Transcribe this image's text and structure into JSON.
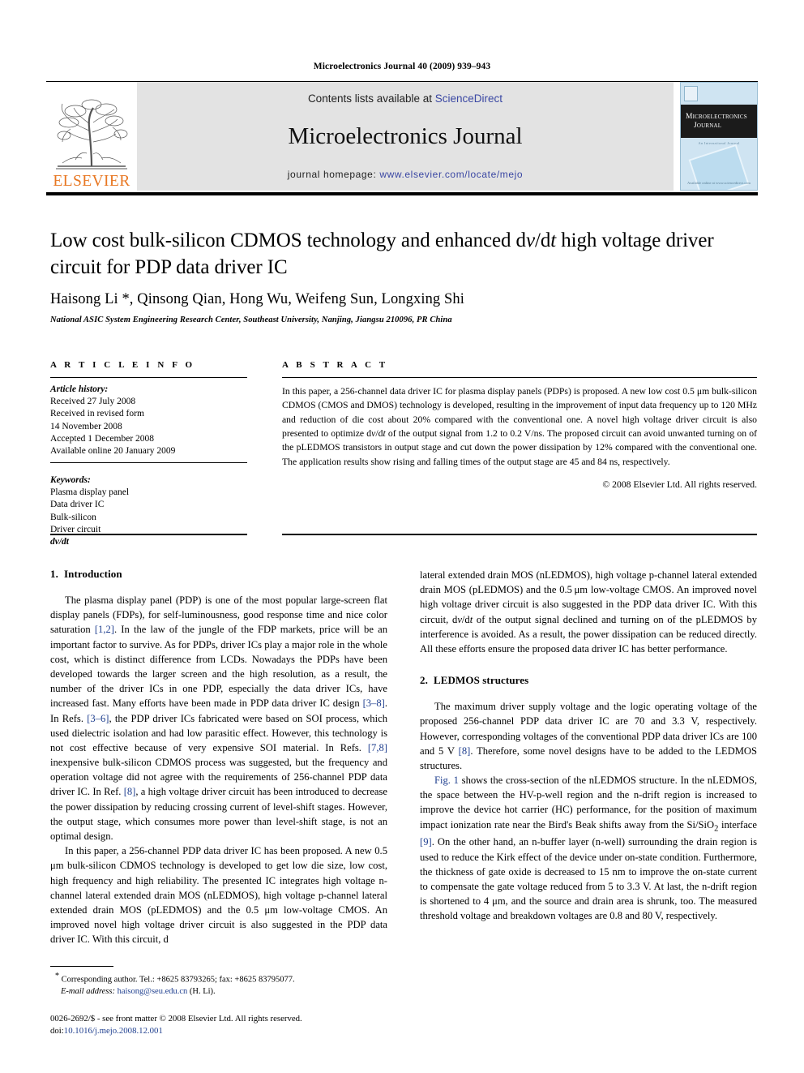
{
  "running_head": "Microelectronics Journal 40 (2009) 939–943",
  "masthead": {
    "publisher_logo_text": "ELSEVIER",
    "contents_prefix": "Contents lists available at ",
    "contents_link": "ScienceDirect",
    "journal_name": "Microelectronics Journal",
    "homepage_prefix": "journal homepage: ",
    "homepage_url": "www.elsevier.com/locate/mejo",
    "cover": {
      "line1": "Microelectronics",
      "line2": "Journal",
      "sub": "An International Journal",
      "foot": "Available online at www.sciencedirect.com"
    }
  },
  "title": {
    "line_a": "Low cost bulk-silicon CDMOS technology and enhanced d",
    "italic_a": "v",
    "line_b": "/d",
    "italic_b": "t",
    "line_c": " high voltage driver circuit for PDP data driver IC"
  },
  "authors": "Haisong Li *, Qinsong Qian, Hong Wu, Weifeng Sun, Longxing Shi",
  "affiliation": "National ASIC System Engineering Research Center, Southeast University, Nanjing, Jiangsu 210096, PR China",
  "article_info": {
    "heading": "A R T I C L E  I N F O",
    "history_label": "Article history:",
    "history": [
      "Received 27 July 2008",
      "Received in revised form",
      "14 November 2008",
      "Accepted 1 December 2008",
      "Available online 20 January 2009"
    ],
    "keywords_label": "Keywords:",
    "keywords": [
      "Plasma display panel",
      "Data driver IC",
      "Bulk-silicon",
      "Driver circuit",
      "dv/dt"
    ]
  },
  "abstract": {
    "heading": "A B S T R A C T",
    "text_1": "In this paper, a 256-channel data driver IC for plasma display panels (PDPs) is proposed. A new low cost 0.5 μm bulk-silicon CDMOS (CMOS and DMOS) technology is developed, resulting in the improvement of input data frequency up to 120 MHz and reduction of die cost about 20% compared with the conventional one. A novel high voltage driver circuit is also presented to optimize d",
    "italic_1": "v",
    "text_2": "/d",
    "italic_2": "t",
    "text_3": " of the output signal from 1.2 to 0.2 V/ns. The proposed circuit can avoid unwanted turning on of the pLEDMOS transistors in output stage and cut down the power dissipation by 12% compared with the conventional one. The application results show rising and falling times of the output stage are 45 and 84 ns, respectively.",
    "copyright": "© 2008 Elsevier Ltd. All rights reserved."
  },
  "sections": {
    "intro": {
      "number": "1.",
      "title": "Introduction",
      "p1_a": "The plasma display panel (PDP) is one of the most popular large-screen flat display panels (FDPs), for self-luminousness, good response time and nice color saturation ",
      "p1_ref1": "[1,2]",
      "p1_b": ". In the law of the jungle of the FDP markets, price will be an important factor to survive. As for PDPs, driver ICs play a major role in the whole cost, which is distinct difference from LCDs. Nowadays the PDPs have been developed towards the larger screen and the high resolution, as a result, the number of the driver ICs in one PDP, especially the data driver ICs, have increased fast. Many efforts have been made in PDP data driver IC design ",
      "p1_ref2": "[3–8]",
      "p1_c": ". In Refs. ",
      "p1_ref3": "[3–6]",
      "p1_d": ", the PDP driver ICs fabricated were based on SOI process, which used dielectric isolation and had low parasitic effect. However, this technology is not cost effective because of very expensive SOI material. In Refs. ",
      "p1_ref4": "[7,8]",
      "p1_e": " inexpensive bulk-silicon CDMOS process was suggested, but the frequency and operation voltage did not agree with the requirements of 256-channel PDP data driver IC. In Ref. ",
      "p1_ref5": "[8]",
      "p1_f": ", a high voltage driver circuit has been introduced to decrease the power dissipation by reducing crossing current of level-shift stages. However, the output stage, which consumes more power than level-shift stage, is not an optimal design.",
      "p2": "In this paper, a 256-channel PDP data driver IC has been proposed. A new 0.5 μm bulk-silicon CDMOS technology is developed to get low die size, low cost, high frequency and high reliability. The presented IC integrates high voltage n-channel lateral extended drain MOS (nLEDMOS), high voltage p-channel lateral extended drain MOS (pLEDMOS) and the 0.5 μm low-voltage CMOS. An improved novel high voltage driver circuit is also suggested in the PDP data driver IC. With this circuit, d",
      "p2_italic_1": "v",
      "p2_b": "/d",
      "p2_italic_2": "t",
      "p2_c": " of the output signal declined and turning on of the pLEDMOS by interference is avoided. As a result, the power dissipation can be reduced directly. All these efforts ensure the proposed data driver IC has better performance."
    },
    "ledmos": {
      "number": "2.",
      "title": "LEDMOS structures",
      "p1_a": "The maximum driver supply voltage and the logic operating voltage of the proposed 256-channel PDP data driver IC are 70 and 3.3 V, respectively. However, corresponding voltages of the conventional PDP data driver ICs are 100 and 5 V ",
      "p1_ref1": "[8]",
      "p1_b": ". Therefore, some novel designs have to be added to the LEDMOS structures.",
      "p2_ref_fig": "Fig. 1",
      "p2_a": " shows the cross-section of the nLEDMOS structure. In the nLEDMOS, the space between the HV-p-well region and the n-drift region is increased to improve the device hot carrier (HC) performance, for the position of maximum impact ionization rate near the Bird's Beak shifts away from the Si/SiO",
      "p2_sub": "2",
      "p2_b": " interface ",
      "p2_ref2": "[9]",
      "p2_c": ". On the other hand, an n-buffer layer (n-well) surrounding the drain region is used to reduce the Kirk effect of the device under on-state condition. Furthermore, the thickness of gate oxide is decreased to 15 nm to improve the on-state current to compensate the gate voltage reduced from 5 to 3.3 V. At last, the n-drift region is shortened to 4 μm, and the source and drain area is shrunk, too. The measured threshold voltage and breakdown voltages are 0.8 and 80 V, respectively."
    }
  },
  "footnote": {
    "star": "*",
    "corresponding": " Corresponding author. Tel.: +8625 83793265; fax: +8625 83795077.",
    "email_label": "E-mail address:",
    "email": " haisong@seu.edu.cn",
    "email_suffix": " (H. Li)."
  },
  "colophon": {
    "line1": "0026-2692/$ - see front matter © 2008 Elsevier Ltd. All rights reserved.",
    "doi_label": "doi:",
    "doi": "10.1016/j.mejo.2008.12.001"
  },
  "colors": {
    "link": "#3a47a3",
    "reference": "#1f3f8f",
    "elsevier_orange": "#E87722",
    "masthead_bg": "#e3e3e3"
  }
}
